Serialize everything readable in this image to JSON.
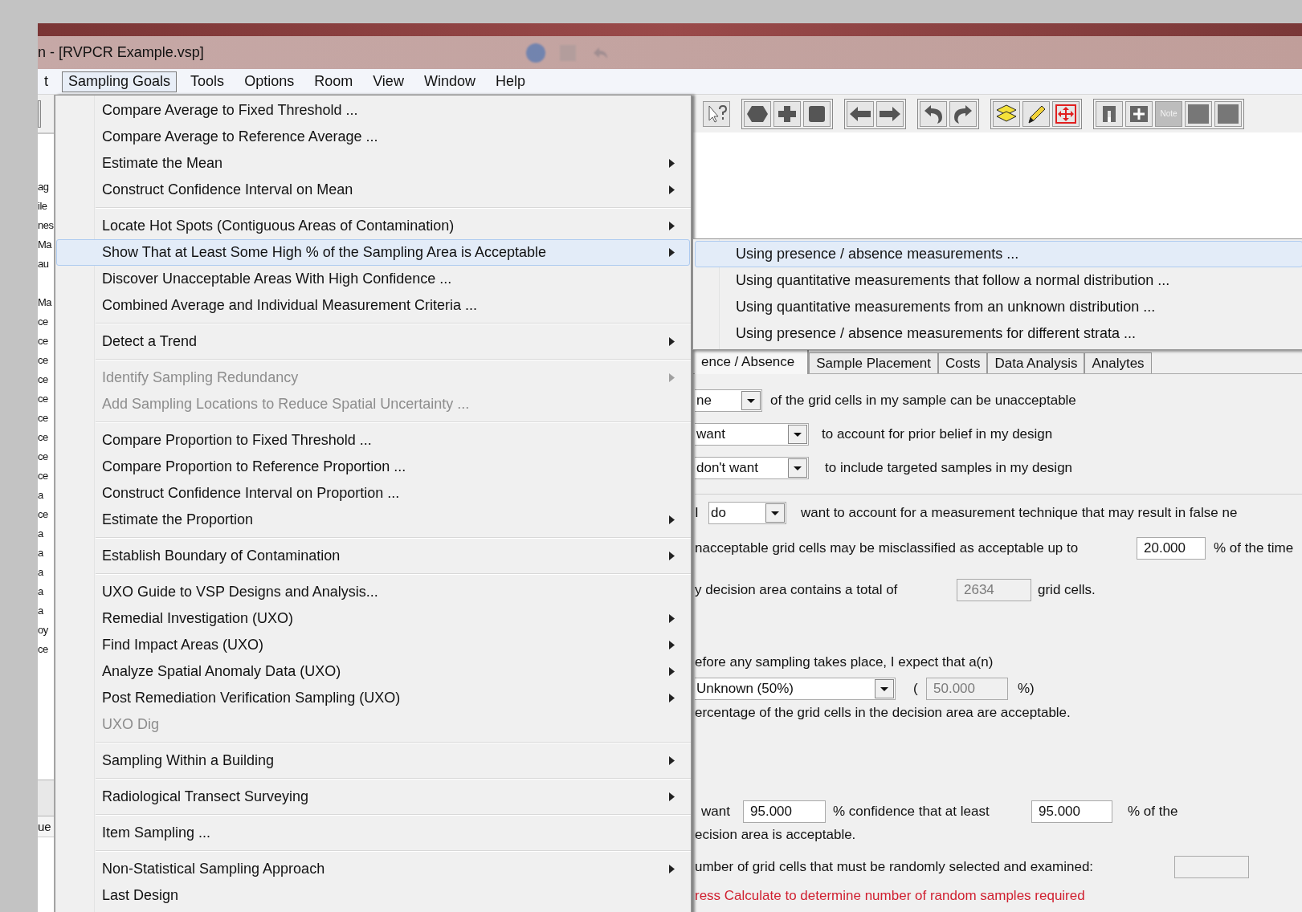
{
  "window": {
    "title": "n - [RVPCR Example.vsp]"
  },
  "menubar": [
    {
      "label": "t",
      "selected": false
    },
    {
      "label": "Sampling Goals",
      "selected": true
    },
    {
      "label": "Tools",
      "selected": false
    },
    {
      "label": "Options",
      "selected": false
    },
    {
      "label": "Room",
      "selected": false
    },
    {
      "label": "View",
      "selected": false
    },
    {
      "label": "Window",
      "selected": false
    },
    {
      "label": "Help",
      "selected": false
    }
  ],
  "toolbar": {
    "note_label": "Note"
  },
  "left_panel": {
    "groups": [
      [
        "ag",
        "ile",
        "nes",
        "Ma",
        "au"
      ],
      [
        "Ma",
        "ce",
        "ce",
        "ce",
        "ce",
        "ce",
        "ce",
        "ce",
        "ce",
        "ce",
        "a",
        "ce",
        "a",
        "a",
        "a",
        "a",
        "a",
        "oy",
        "ce"
      ]
    ],
    "footer": "ue"
  },
  "menu": {
    "groups": [
      [
        {
          "label": "Compare Average to Fixed Threshold ...",
          "submenu": false,
          "disabled": false,
          "selected": false
        },
        {
          "label": "Compare Average to Reference Average ...",
          "submenu": false,
          "disabled": false,
          "selected": false
        },
        {
          "label": "Estimate the Mean",
          "submenu": true,
          "disabled": false,
          "selected": false
        },
        {
          "label": "Construct Confidence Interval on Mean",
          "submenu": true,
          "disabled": false,
          "selected": false
        }
      ],
      [
        {
          "label": "Locate Hot Spots (Contiguous Areas of Contamination)",
          "submenu": true,
          "disabled": false,
          "selected": false
        },
        {
          "label": "Show That at Least Some High % of the Sampling Area is Acceptable",
          "submenu": true,
          "disabled": false,
          "selected": true
        },
        {
          "label": "Discover Unacceptable Areas With High Confidence ...",
          "submenu": false,
          "disabled": false,
          "selected": false
        },
        {
          "label": "Combined Average and Individual Measurement Criteria ...",
          "submenu": false,
          "disabled": false,
          "selected": false
        }
      ],
      [
        {
          "label": "Detect a Trend",
          "submenu": true,
          "disabled": false,
          "selected": false
        }
      ],
      [
        {
          "label": "Identify Sampling Redundancy",
          "submenu": true,
          "disabled": true,
          "selected": false
        },
        {
          "label": "Add Sampling Locations to Reduce Spatial Uncertainty ...",
          "submenu": false,
          "disabled": true,
          "selected": false
        }
      ],
      [
        {
          "label": "Compare Proportion to Fixed Threshold ...",
          "submenu": false,
          "disabled": false,
          "selected": false
        },
        {
          "label": "Compare Proportion to Reference Proportion ...",
          "submenu": false,
          "disabled": false,
          "selected": false
        },
        {
          "label": "Construct Confidence Interval on Proportion ...",
          "submenu": false,
          "disabled": false,
          "selected": false
        },
        {
          "label": "Estimate the Proportion",
          "submenu": true,
          "disabled": false,
          "selected": false
        }
      ],
      [
        {
          "label": "Establish Boundary of Contamination",
          "submenu": true,
          "disabled": false,
          "selected": false
        }
      ],
      [
        {
          "label": "UXO Guide to VSP Designs and Analysis...",
          "submenu": false,
          "disabled": false,
          "selected": false
        },
        {
          "label": "Remedial Investigation (UXO)",
          "submenu": true,
          "disabled": false,
          "selected": false
        },
        {
          "label": "Find Impact Areas (UXO)",
          "submenu": true,
          "disabled": false,
          "selected": false
        },
        {
          "label": "Analyze Spatial Anomaly Data (UXO)",
          "submenu": true,
          "disabled": false,
          "selected": false
        },
        {
          "label": "Post Remediation Verification Sampling (UXO)",
          "submenu": true,
          "disabled": false,
          "selected": false
        },
        {
          "label": "UXO Dig",
          "submenu": false,
          "disabled": true,
          "selected": false
        }
      ],
      [
        {
          "label": "Sampling Within a Building",
          "submenu": true,
          "disabled": false,
          "selected": false
        }
      ],
      [
        {
          "label": "Radiological Transect Surveying",
          "submenu": true,
          "disabled": false,
          "selected": false
        }
      ],
      [
        {
          "label": "Item Sampling ...",
          "submenu": false,
          "disabled": false,
          "selected": false
        }
      ],
      [
        {
          "label": "Non-Statistical Sampling Approach",
          "submenu": true,
          "disabled": false,
          "selected": false
        },
        {
          "label": "Last Design",
          "submenu": false,
          "disabled": false,
          "selected": false
        }
      ]
    ]
  },
  "submenu": {
    "items": [
      {
        "label": "Using presence / absence measurements ...",
        "selected": true
      },
      {
        "label": "Using quantitative measurements that follow a normal distribution ...",
        "selected": false
      },
      {
        "label": "Using quantitative measurements from an unknown distribution ...",
        "selected": false
      },
      {
        "label": "Using presence / absence measurements for different strata ...",
        "selected": false
      }
    ]
  },
  "tabs": [
    {
      "label": "ence / Absence",
      "selected": true
    },
    {
      "label": "Sample Placement",
      "selected": false
    },
    {
      "label": "Costs",
      "selected": false
    },
    {
      "label": "Data Analysis",
      "selected": false
    },
    {
      "label": "Analytes",
      "selected": false
    }
  ],
  "form": {
    "unacceptable_row": {
      "dropdown": "ne",
      "text": "of the grid cells in my sample can be unacceptable"
    },
    "prior_row": {
      "dropdown": "want",
      "text": "to account for prior belief in my design"
    },
    "targeted_row": {
      "dropdown": "don't want",
      "text": "to include targeted samples in my design"
    },
    "false_negative_row": {
      "prefix": "I",
      "dropdown": "do",
      "text": "want to account for a measurement technique that may result in false ne"
    },
    "misclassified_row": {
      "text": "nacceptable grid cells may be misclassified as acceptable up to",
      "field": {
        "value": "20.000",
        "disabled": false
      },
      "suffix": "% of the time"
    },
    "total_row": {
      "text": "y decision area contains a total of",
      "field": {
        "value": "2634",
        "disabled": true
      },
      "suffix": "grid cells."
    },
    "expect_text": "efore any sampling takes place, I expect that a(n)",
    "expect_row": {
      "dropdown": "Unknown (50%)",
      "open": "(",
      "field": {
        "value": "50.000",
        "disabled": true
      },
      "suffix": "%)"
    },
    "expect_tail": "ercentage of the grid cells in the decision area are acceptable.",
    "confidence_row": {
      "prefix": "want",
      "field": {
        "value": "95.000",
        "disabled": false
      },
      "middle": "% confidence that at least",
      "field2": {
        "value": "95.000",
        "disabled": false
      },
      "suffix": "% of the"
    },
    "confidence_tail": "ecision area is acceptable.",
    "number_row": {
      "text": "umber of grid cells that must be randomly selected and examined:",
      "field": {
        "disabled": true
      }
    },
    "message": "ress Calculate to determine number of random samples required"
  }
}
